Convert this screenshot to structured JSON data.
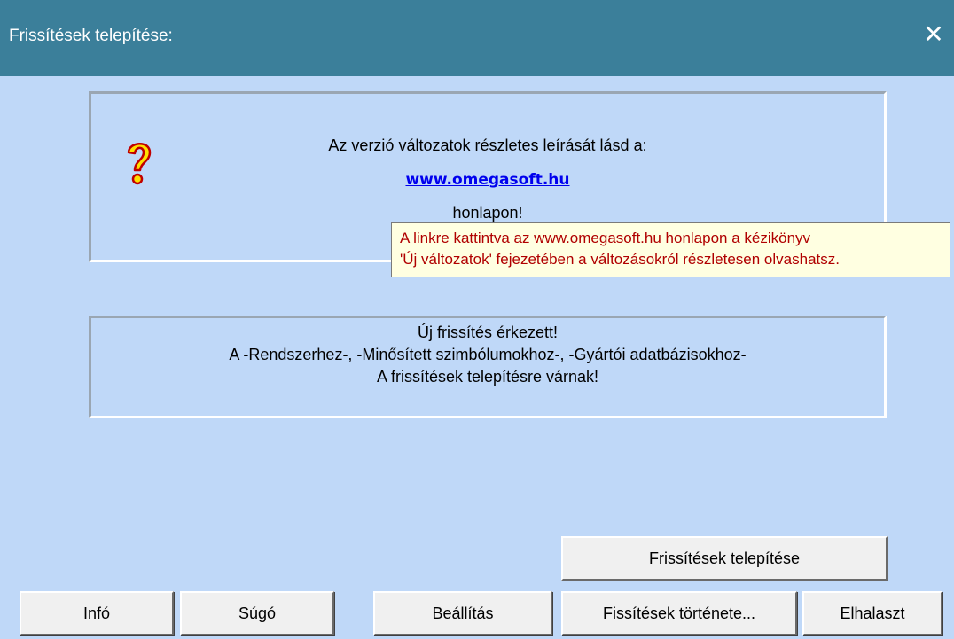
{
  "window": {
    "title": "Frissítések telepítése:",
    "close_symbol": "✕"
  },
  "info_panel": {
    "icon": "question-mark-icon",
    "line1": "Az verzió változatok részletes leírását lásd a:",
    "link_text": "www.omegasoft.hu",
    "line3": "honlapon!"
  },
  "tooltip": {
    "line1": "A linkre kattintva az www.omegasoft.hu honlapon a kézikönyv",
    "line2": "'Új változatok' fejezetében a változásokról részletesen olvashatsz."
  },
  "status_panel": {
    "line1": "Új frissítés érkezett!",
    "line2": "A -Rendszerhez-, -Minősített szimbólumokhoz-, -Gyártói adatbázisokhoz-",
    "line3": "A frissítések telepítésre várnak!"
  },
  "buttons": {
    "install": "Frissítések telepítése",
    "info": "Infó",
    "help": "Súgó",
    "settings": "Beállítás",
    "history": "Fissítések története...",
    "postpone": "Elhalaszt"
  },
  "colors": {
    "titlebar": "#3b7f9a",
    "background": "#bfd8f8",
    "link": "#0000ee",
    "tooltip_text": "#b00000",
    "tooltip_bg": "#ffffe1"
  }
}
